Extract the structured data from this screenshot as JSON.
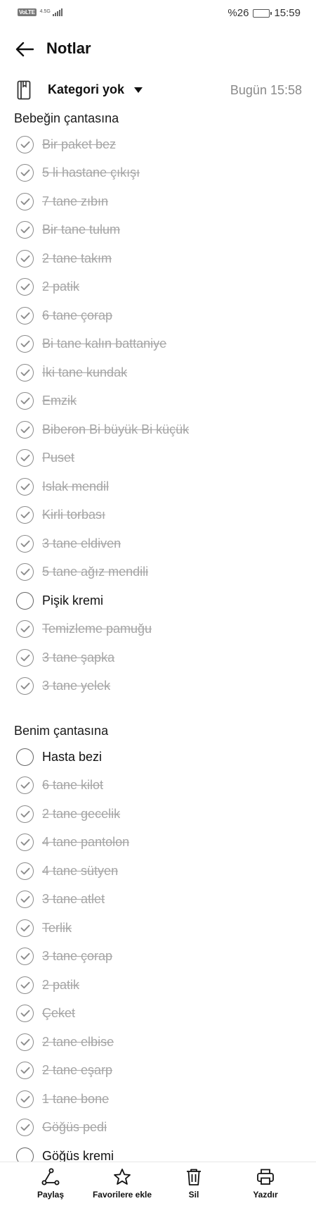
{
  "status_bar": {
    "volte": "VoLTE",
    "network": "4.5G",
    "battery_percent": "%26",
    "battery_level": 0.26,
    "time": "15:59"
  },
  "header": {
    "title": "Notlar",
    "back_icon": "arrow-left-icon"
  },
  "meta": {
    "notebook_icon": "notebook-icon",
    "category": "Kategori yok",
    "timestamp": "Bugün 15:58"
  },
  "sections": [
    {
      "title": "Bebeğin çantasına",
      "items": [
        {
          "label": "Bir paket bez",
          "checked": true
        },
        {
          "label": "5 li hastane çıkışı",
          "checked": true
        },
        {
          "label": "7 tane zıbın",
          "checked": true
        },
        {
          "label": "Bir tane tulum",
          "checked": true
        },
        {
          "label": "2 tane takım",
          "checked": true
        },
        {
          "label": "2 patik",
          "checked": true
        },
        {
          "label": "6 tane çorap",
          "checked": true
        },
        {
          "label": "Bi tane kalın battaniye",
          "checked": true
        },
        {
          "label": "İki tane kundak",
          "checked": true
        },
        {
          "label": "Emzik",
          "checked": true
        },
        {
          "label": "Biberon Bi büyük Bi küçük",
          "checked": true
        },
        {
          "label": "Puset",
          "checked": true
        },
        {
          "label": "Islak mendil",
          "checked": true
        },
        {
          "label": "Kirli torbası",
          "checked": true
        },
        {
          "label": "3 tane eldiven",
          "checked": true
        },
        {
          "label": "5 tane ağız mendili",
          "checked": true
        },
        {
          "label": "Pişik kremi",
          "checked": false
        },
        {
          "label": "Temizleme pamuğu",
          "checked": true
        },
        {
          "label": "3 tane şapka",
          "checked": true
        },
        {
          "label": "3 tane yelek",
          "checked": true
        }
      ]
    },
    {
      "title": "Benim çantasına",
      "items": [
        {
          "label": "Hasta bezi",
          "checked": false
        },
        {
          "label": "6 tane kilot",
          "checked": true
        },
        {
          "label": "2 tane gecelik",
          "checked": true
        },
        {
          "label": "4 tane pantolon",
          "checked": true
        },
        {
          "label": "4 tane sütyen",
          "checked": true
        },
        {
          "label": "3 tane atlet",
          "checked": true
        },
        {
          "label": "Terlik",
          "checked": true
        },
        {
          "label": "3 tane çorap",
          "checked": true
        },
        {
          "label": "2 patik",
          "checked": true
        },
        {
          "label": "Çeket",
          "checked": true
        },
        {
          "label": "2 tane elbise",
          "checked": true
        },
        {
          "label": "2 tane eşarp",
          "checked": true
        },
        {
          "label": "1 tane bone",
          "checked": true
        },
        {
          "label": "Göğüs pedi",
          "checked": true
        },
        {
          "label": "Göğüs kremi",
          "checked": false
        }
      ]
    }
  ],
  "bottom_bar": [
    {
      "label": "Paylaş",
      "icon": "share-icon"
    },
    {
      "label": "Favorilere ekle",
      "icon": "star-icon"
    },
    {
      "label": "Sil",
      "icon": "trash-icon"
    },
    {
      "label": "Yazdır",
      "icon": "printer-icon"
    }
  ],
  "colors": {
    "done_text": "#a6a6a6",
    "active_text": "#111111",
    "timestamp": "#8a8a8a"
  }
}
